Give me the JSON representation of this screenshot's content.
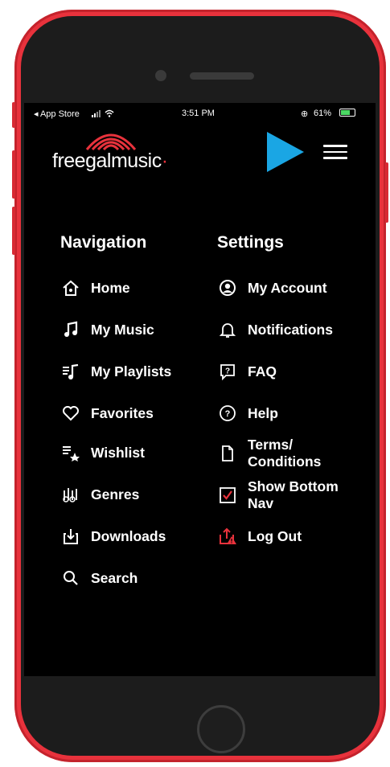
{
  "status_bar": {
    "back_app": "◂ App Store",
    "time": "3:51 PM",
    "battery": "61%"
  },
  "logo": {
    "word1": "freegal",
    "word2": "music"
  },
  "navigation": {
    "title": "Navigation",
    "items": [
      {
        "label": "Home",
        "icon": "home-icon"
      },
      {
        "label": "My Music",
        "icon": "music-note-icon"
      },
      {
        "label": "My Playlists",
        "icon": "playlist-icon"
      },
      {
        "label": "Favorites",
        "icon": "heart-icon"
      },
      {
        "label": "Wishlist",
        "icon": "wishlist-star-icon"
      },
      {
        "label": "Genres",
        "icon": "genres-icon"
      },
      {
        "label": "Downloads",
        "icon": "download-icon"
      },
      {
        "label": "Search",
        "icon": "search-icon"
      }
    ]
  },
  "settings": {
    "title": "Settings",
    "items": [
      {
        "label": "My Account",
        "icon": "account-icon"
      },
      {
        "label": "Notifications",
        "icon": "bell-icon"
      },
      {
        "label": "FAQ",
        "icon": "faq-icon"
      },
      {
        "label": "Help",
        "icon": "help-icon"
      },
      {
        "label": "Terms/\nConditions",
        "icon": "document-icon"
      },
      {
        "label": "Show Bottom\nNav",
        "icon": "checkbox-icon",
        "checked": true
      },
      {
        "label": "Log Out",
        "icon": "logout-icon"
      }
    ]
  },
  "colors": {
    "phone_frame": "#e8323c",
    "accent_red": "#e8323c",
    "play_arrow": "#1aa6e4",
    "screen_bg": "#000000"
  }
}
